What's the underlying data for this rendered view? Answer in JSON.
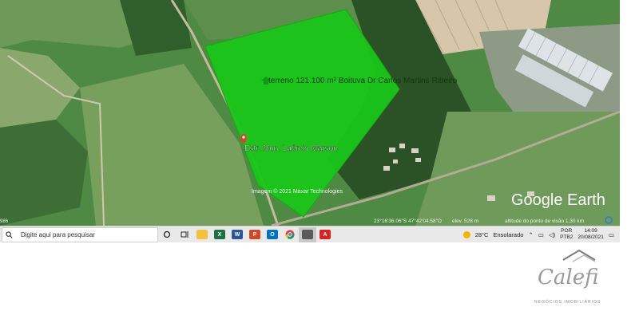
{
  "map": {
    "polygon_label": "terreno 121.100 m² Boituva Dr Carlos Martins Ribeiro",
    "road_label": "Estr. Mun. Laércio Marson",
    "imagery_credit": "Imagem © 2021 Maxar Technologies",
    "brand": "Google Earth",
    "edge_label": "986",
    "status_coords": "23°16'36.06\"S 47°42'04.58\"O",
    "status_elev": "elev. 528 m",
    "status_eye_alt": "altitude do ponto de visão 1,30 km",
    "polygon_color": "#19c619",
    "placemark_color": "#e53935"
  },
  "taskbar": {
    "search_placeholder": "Digite aqui para pesquisar",
    "apps": [
      "cortana-icon",
      "task-view-icon",
      "file-explorer-icon",
      "excel-icon",
      "word-icon",
      "powerpoint-icon",
      "outlook-icon",
      "chrome-icon",
      "photos-icon",
      "acrobat-icon"
    ],
    "weather_temp": "28°C",
    "weather_text": "Ensolarado",
    "language": "POR",
    "layout": "PTB2",
    "time": "14:09",
    "date": "20/08/2021"
  },
  "logo": {
    "name": "Calefi",
    "tagline": "NEGÓCIOS IMOBILIÁRIOS"
  }
}
